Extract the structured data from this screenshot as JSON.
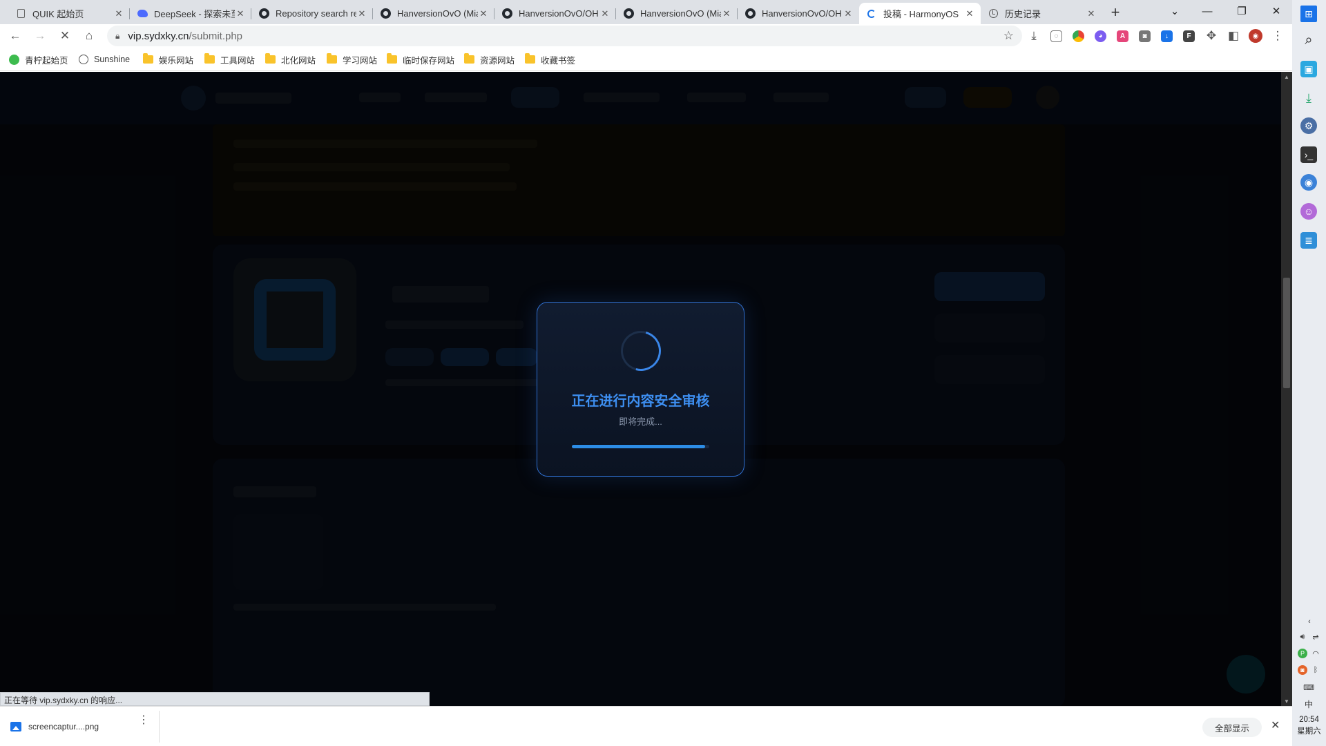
{
  "tabs": [
    {
      "title": "QUIK 起始页",
      "icon": "page-icon"
    },
    {
      "title": "DeepSeek - 探索未至之境",
      "icon": "deepseek-icon"
    },
    {
      "title": "Repository search results",
      "icon": "github-icon"
    },
    {
      "title": "HanversionOvO (Miao)",
      "icon": "github-icon"
    },
    {
      "title": "HanversionOvO/OH",
      "icon": "github-icon"
    },
    {
      "title": "HanversionOvO (Miao)",
      "icon": "github-icon"
    },
    {
      "title": "HanversionOvO/OH",
      "icon": "github-icon"
    },
    {
      "title": "投稿 - HarmonyOS",
      "icon": "loading-icon",
      "active": true
    },
    {
      "title": "历史记录",
      "icon": "history-icon"
    }
  ],
  "toolbar": {
    "url_host": "vip.sydxky.cn",
    "url_path": "/submit.php"
  },
  "bookmarks": [
    {
      "label": "青柠起始页",
      "icon": "leaf-icon"
    },
    {
      "label": "Sunshine",
      "icon": "globe-icon"
    },
    {
      "label": "娱乐网站",
      "icon": "folder-icon"
    },
    {
      "label": "工具网站",
      "icon": "folder-icon"
    },
    {
      "label": "北化网站",
      "icon": "folder-icon"
    },
    {
      "label": "学习网站",
      "icon": "folder-icon"
    },
    {
      "label": "临时保存网站",
      "icon": "folder-icon"
    },
    {
      "label": "资源网站",
      "icon": "folder-icon"
    },
    {
      "label": "收藏书签",
      "icon": "folder-icon"
    }
  ],
  "modal": {
    "title": "正在进行内容安全审核",
    "subtitle": "即将完成...",
    "progress": 0.97,
    "accent": "#3d8ef0"
  },
  "status": {
    "text": "正在等待 vip.sydxky.cn 的响应..."
  },
  "downloads": {
    "file_name": "screencaptur....png",
    "show_all_label": "全部显示"
  },
  "system_tray": {
    "time": "20:54",
    "weekday": "星期六",
    "ime": "中"
  }
}
